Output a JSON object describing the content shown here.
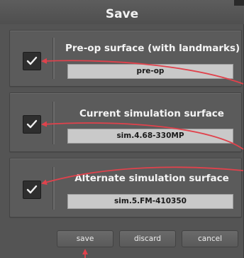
{
  "dialog": {
    "title": "Save"
  },
  "panels": [
    {
      "label": "Pre-op surface (with landmarks)",
      "value": "pre-op",
      "checked": true
    },
    {
      "label": "Current simulation surface",
      "value": "sim.4.68-330MP",
      "checked": true
    },
    {
      "label": "Alternate simulation surface",
      "value": "sim.5.FM-410350",
      "checked": true
    }
  ],
  "buttons": {
    "save": "save",
    "discard": "discard",
    "cancel": "cancel"
  },
  "colors": {
    "annotation_arrow": "#e0424c",
    "field_bg": "#c9c9c9",
    "dialog_bg": "#545454"
  }
}
